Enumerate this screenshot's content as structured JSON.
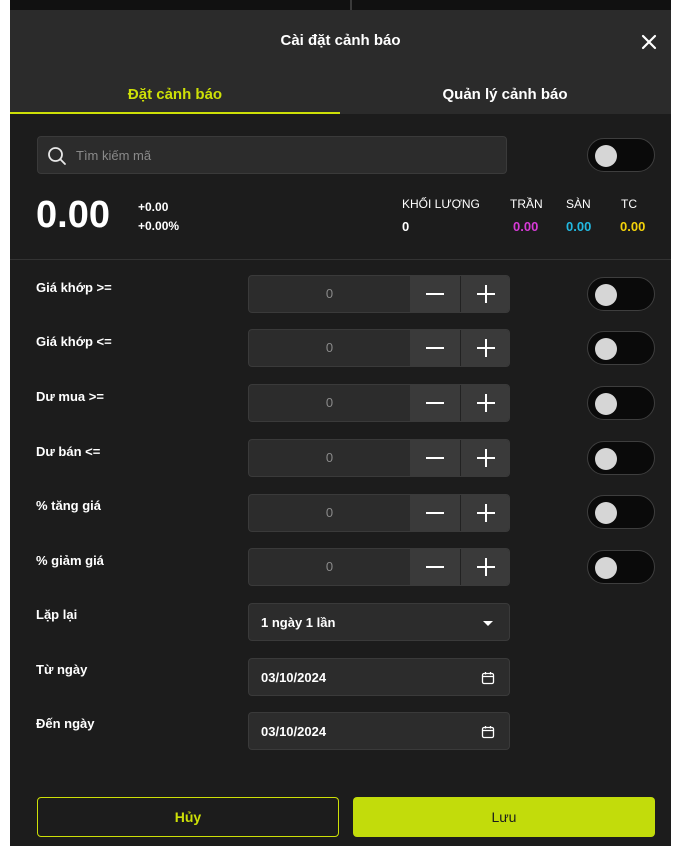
{
  "dialog": {
    "title": "Cài đặt cảnh báo",
    "close_icon": "close-icon"
  },
  "tabs": [
    {
      "label": "Đặt cảnh báo",
      "active": true
    },
    {
      "label": "Quản lý cảnh báo",
      "active": false
    }
  ],
  "search": {
    "placeholder": "Tìm kiếm mã",
    "value": "",
    "icon": "search-icon",
    "toggle_on": false
  },
  "quote": {
    "price": "0.00",
    "change": "+0.00",
    "change_pct": "+0.00%",
    "stats": [
      {
        "label": "KHỐI LƯỢNG",
        "value": "0",
        "color": "#ffffff"
      },
      {
        "label": "TRẦN",
        "value": "0.00",
        "color": "#d63ad6"
      },
      {
        "label": "SÀN",
        "value": "0.00",
        "color": "#22b8e0"
      },
      {
        "label": "TC",
        "value": "0.00",
        "color": "#f2d20a"
      }
    ]
  },
  "conditions": [
    {
      "label": "Giá khớp >=",
      "value": "0",
      "enabled": false
    },
    {
      "label": "Giá khớp <=",
      "value": "0",
      "enabled": false
    },
    {
      "label": "Dư mua >=",
      "value": "0",
      "enabled": false
    },
    {
      "label": "Dư bán <=",
      "value": "0",
      "enabled": false
    },
    {
      "label": "% tăng giá",
      "value": "0",
      "enabled": false
    },
    {
      "label": "% giảm giá",
      "value": "0",
      "enabled": false
    }
  ],
  "repeat": {
    "label": "Lặp lại",
    "value": "1 ngày 1 lần",
    "icon": "caret-down-icon"
  },
  "from_date": {
    "label": "Từ ngày",
    "value": "03/10/2024",
    "icon": "calendar-icon"
  },
  "to_date": {
    "label": "Đến ngày",
    "value": "03/10/2024",
    "icon": "calendar-icon"
  },
  "actions": {
    "cancel": "Hủy",
    "save": "Lưu"
  },
  "colors": {
    "accent": "#cde007",
    "save_bg": "#c2dc0b",
    "panel": "#1c1c1c",
    "header": "#2b2b2b"
  }
}
